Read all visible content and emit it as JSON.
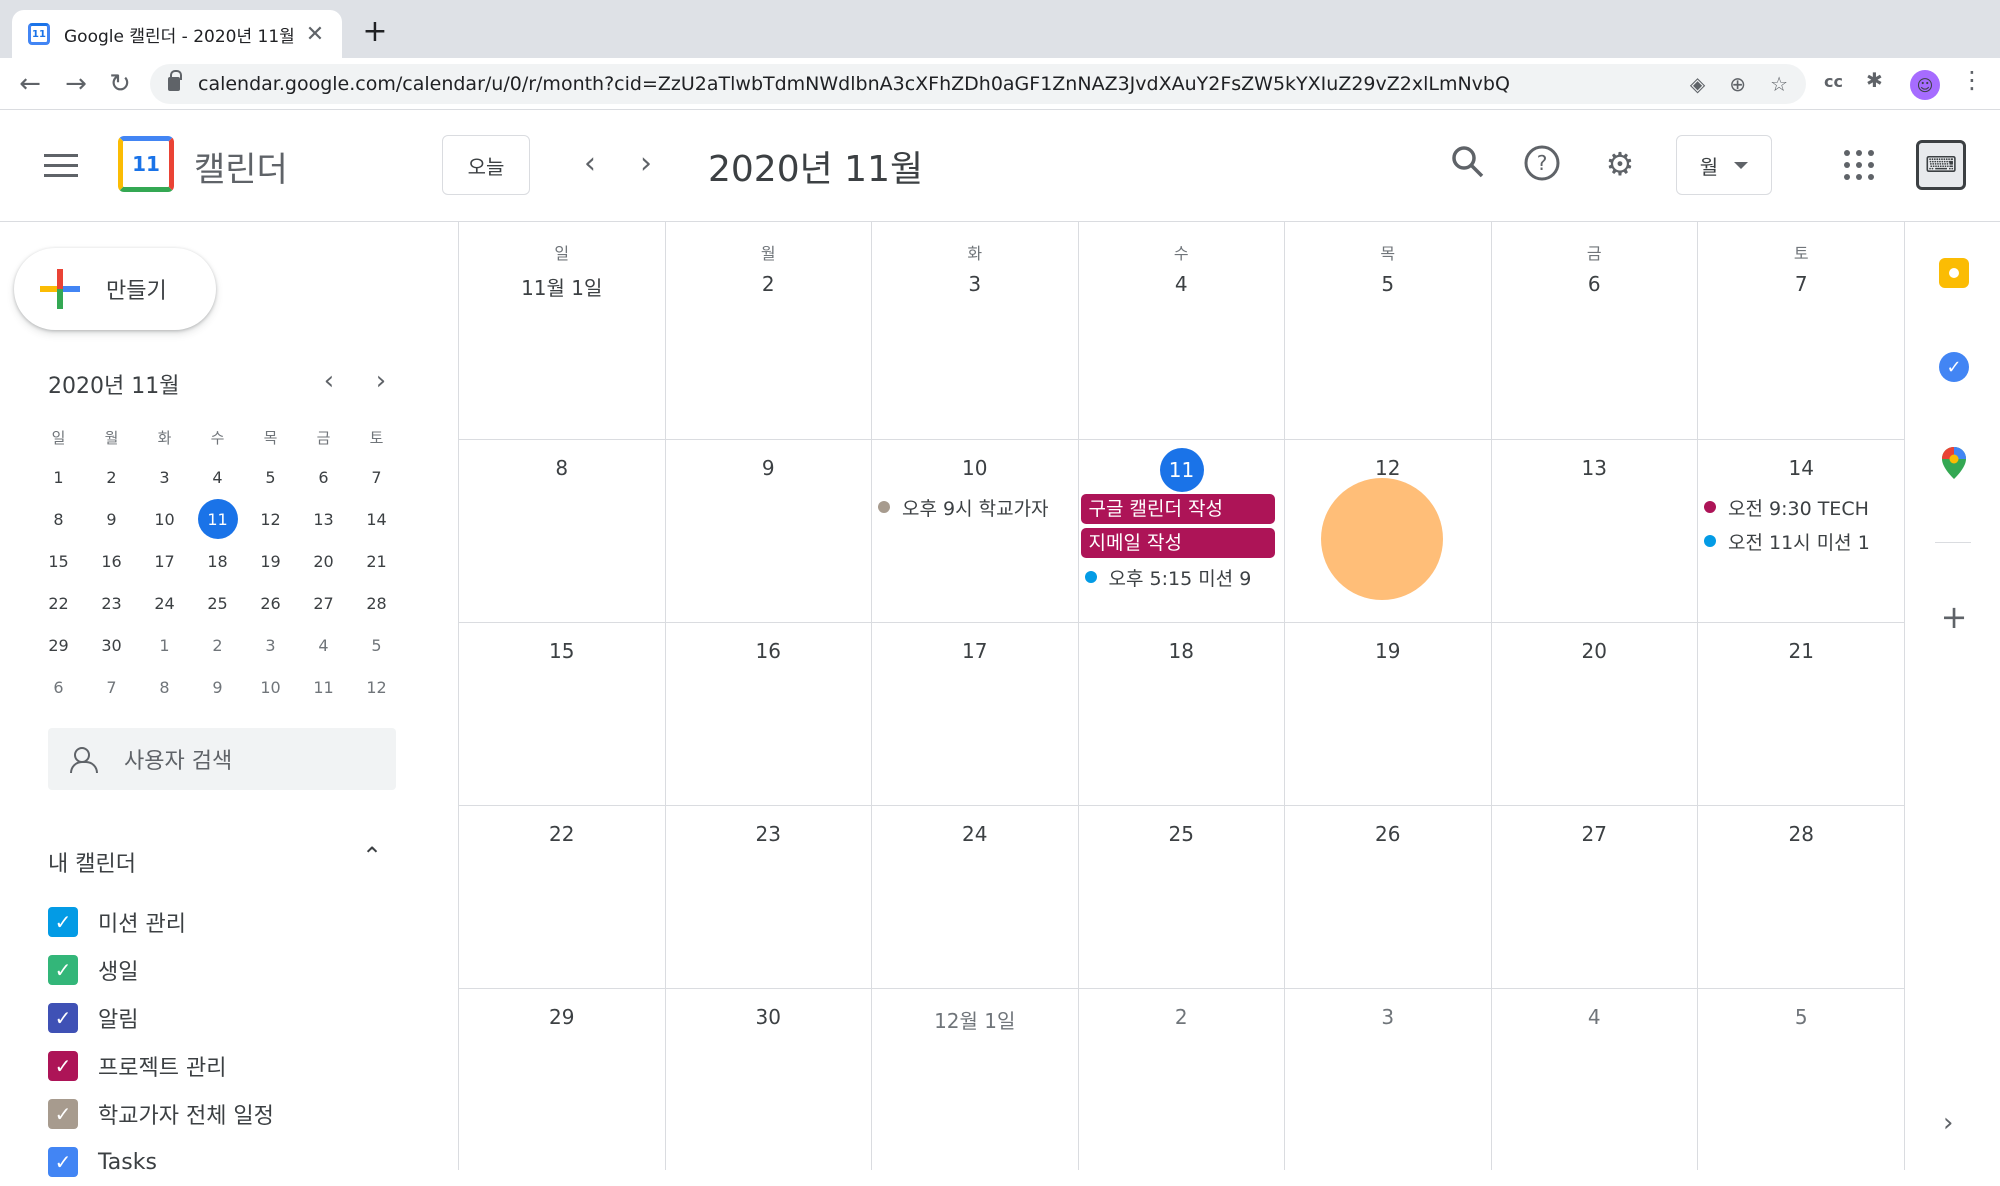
{
  "browser": {
    "tab_title": "Google 캘린더 - 2020년 11월",
    "url": "calendar.google.com/calendar/u/0/r/month?cid=ZzU2aTlwbTdmNWdlbnA3cXFhZDh0aGF1ZnNAZ3JvdXAuY2FsZW5kYXIuZ29vZ2xlLmNvbQ",
    "favicon_text": "11"
  },
  "header": {
    "app_title": "캘린더",
    "logo_text": "11",
    "today_label": "오늘",
    "month_title": "2020년 11월",
    "view_label": "월"
  },
  "sidebar": {
    "create_label": "만들기",
    "mini_title": "2020년 11월",
    "dow": [
      "일",
      "월",
      "화",
      "수",
      "목",
      "금",
      "토"
    ],
    "mini_weeks": [
      [
        "1",
        "2",
        "3",
        "4",
        "5",
        "6",
        "7"
      ],
      [
        "8",
        "9",
        "10",
        "11",
        "12",
        "13",
        "14"
      ],
      [
        "15",
        "16",
        "17",
        "18",
        "19",
        "20",
        "21"
      ],
      [
        "22",
        "23",
        "24",
        "25",
        "26",
        "27",
        "28"
      ],
      [
        "29",
        "30",
        "1",
        "2",
        "3",
        "4",
        "5"
      ],
      [
        "6",
        "7",
        "8",
        "9",
        "10",
        "11",
        "12"
      ]
    ],
    "people_search_placeholder": "사용자 검색",
    "my_calendars_title": "내 캘린더",
    "calendars": [
      {
        "label": "미션 관리",
        "color": "#039be5"
      },
      {
        "label": "생일",
        "color": "#33b679"
      },
      {
        "label": "알림",
        "color": "#3f51b5"
      },
      {
        "label": "프로젝트 관리",
        "color": "#ad1457"
      },
      {
        "label": "학교가자 전체 일정",
        "color": "#a79b8e"
      },
      {
        "label": "Tasks",
        "color": "#4285f4"
      }
    ]
  },
  "month": {
    "dow": [
      "일",
      "월",
      "화",
      "수",
      "목",
      "금",
      "토"
    ],
    "weeks": [
      [
        "11월 1일",
        "2",
        "3",
        "4",
        "5",
        "6",
        "7"
      ],
      [
        "8",
        "9",
        "10",
        "11",
        "12",
        "13",
        "14"
      ],
      [
        "15",
        "16",
        "17",
        "18",
        "19",
        "20",
        "21"
      ],
      [
        "22",
        "23",
        "24",
        "25",
        "26",
        "27",
        "28"
      ],
      [
        "29",
        "30",
        "12월 1일",
        "2",
        "3",
        "4",
        "5"
      ]
    ],
    "events": {
      "w1d2": {
        "text": "오후 9시 학교가자",
        "color": "#a79b8e"
      },
      "w1d3_chip1": "구글 캘린더 작성",
      "w1d3_chip2": "지메일 작성",
      "w1d3_dot": {
        "text": "오후 5:15 미션 9",
        "color": "#039be5"
      },
      "w1d6_dot1": {
        "text": "오전 9:30 TECH",
        "color": "#ad1457"
      },
      "w1d6_dot2": {
        "text": "오전 11시 미션 1",
        "color": "#039be5"
      }
    }
  }
}
